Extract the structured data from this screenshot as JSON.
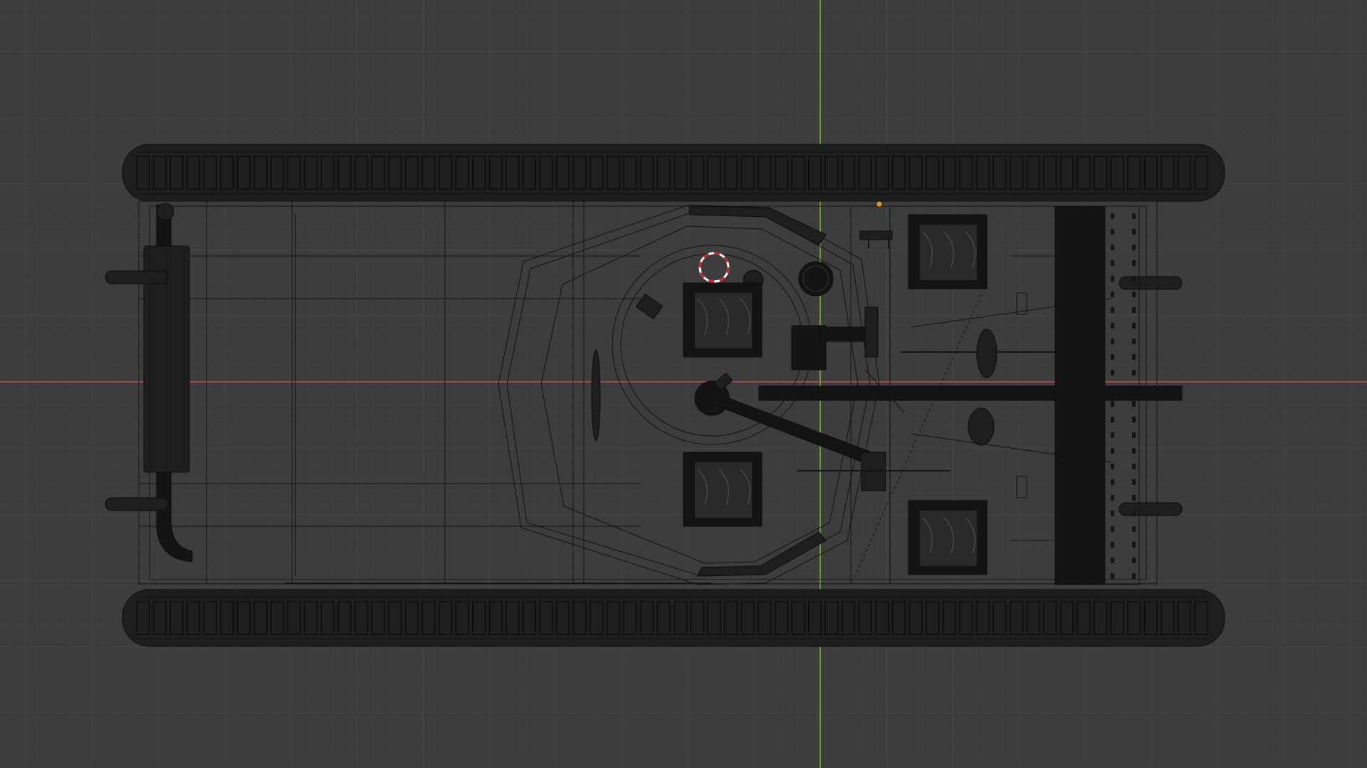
{
  "viewport": {
    "mode": "top-orthographic-wireframe",
    "grid_color": "#464646",
    "background_color": "#3d3d3d",
    "x_axis_color": "#a3454d",
    "y_axis_color": "#6c9a2b",
    "wire_color": "#121212",
    "cursor_icon": "3d-cursor-icon",
    "origin_icon": "object-origin-icon",
    "origin_color": "#e8901a"
  },
  "model": {
    "name": "",
    "track_link_count": 64
  }
}
